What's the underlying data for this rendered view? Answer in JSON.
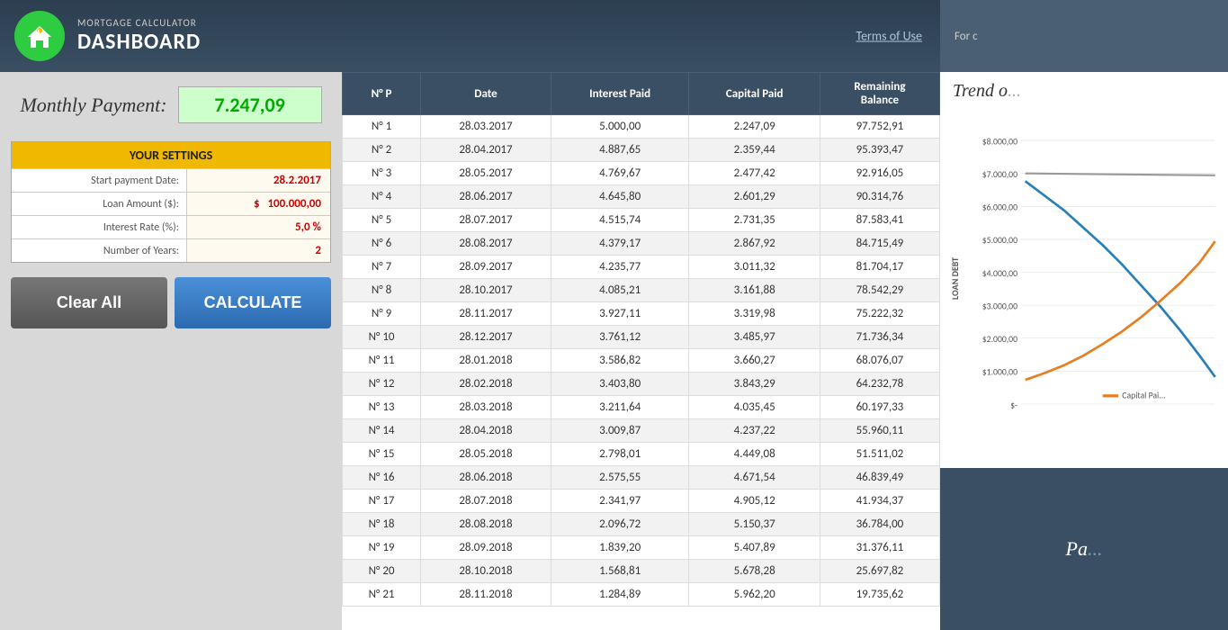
{
  "header": {
    "logo_alt": "house-icon",
    "subtitle": "MORTGAGE CALCULATOR",
    "title": "DASHBOARD",
    "terms_label": "Terms of Use",
    "for_label": "For c"
  },
  "monthly_payment": {
    "label": "Monthly Payment:",
    "value": "7.247,09"
  },
  "settings": {
    "title": "YOUR SETTINGS",
    "fields": [
      {
        "label": "Start payment Date:",
        "value": "28.2.2017"
      },
      {
        "label": "Loan Amount ($):",
        "value": "$   100.000,00"
      },
      {
        "label": "Interest Rate (%):",
        "value": "5,0 %"
      },
      {
        "label": "Number of Years:",
        "value": "2"
      }
    ]
  },
  "buttons": {
    "clear_label": "Clear All",
    "calculate_label": "CALCULATE"
  },
  "table": {
    "headers": [
      "N° P",
      "Date",
      "Interest Paid",
      "Capital Paid",
      "Remaining\nBalance"
    ],
    "rows": [
      [
        "N° 1",
        "28.03.2017",
        "5.000,00",
        "2.247,09",
        "97.752,91"
      ],
      [
        "N° 2",
        "28.04.2017",
        "4.887,65",
        "2.359,44",
        "95.393,47"
      ],
      [
        "N° 3",
        "28.05.2017",
        "4.769,67",
        "2.477,42",
        "92.916,05"
      ],
      [
        "N° 4",
        "28.06.2017",
        "4.645,80",
        "2.601,29",
        "90.314,76"
      ],
      [
        "N° 5",
        "28.07.2017",
        "4.515,74",
        "2.731,35",
        "87.583,41"
      ],
      [
        "N° 6",
        "28.08.2017",
        "4.379,17",
        "2.867,92",
        "84.715,49"
      ],
      [
        "N° 7",
        "28.09.2017",
        "4.235,77",
        "3.011,32",
        "81.704,17"
      ],
      [
        "N° 8",
        "28.10.2017",
        "4.085,21",
        "3.161,88",
        "78.542,29"
      ],
      [
        "N° 9",
        "28.11.2017",
        "3.927,11",
        "3.319,98",
        "75.222,32"
      ],
      [
        "N° 10",
        "28.12.2017",
        "3.761,12",
        "3.485,97",
        "71.736,34"
      ],
      [
        "N° 11",
        "28.01.2018",
        "3.586,82",
        "3.660,27",
        "68.076,07"
      ],
      [
        "N° 12",
        "28.02.2018",
        "3.403,80",
        "3.843,29",
        "64.232,78"
      ],
      [
        "N° 13",
        "28.03.2018",
        "3.211,64",
        "4.035,45",
        "60.197,33"
      ],
      [
        "N° 14",
        "28.04.2018",
        "3.009,87",
        "4.237,22",
        "55.960,11"
      ],
      [
        "N° 15",
        "28.05.2018",
        "2.798,01",
        "4.449,08",
        "51.511,02"
      ],
      [
        "N° 16",
        "28.06.2018",
        "2.575,55",
        "4.671,54",
        "46.839,49"
      ],
      [
        "N° 17",
        "28.07.2018",
        "2.341,97",
        "4.905,12",
        "41.934,37"
      ],
      [
        "N° 18",
        "28.08.2018",
        "2.096,72",
        "5.150,37",
        "36.784,00"
      ],
      [
        "N° 19",
        "28.09.2018",
        "1.839,20",
        "5.407,89",
        "31.376,11"
      ],
      [
        "N° 20",
        "28.10.2018",
        "1.568,81",
        "5.678,28",
        "25.697,82"
      ],
      [
        "N° 21",
        "28.11.2018",
        "1.284,89",
        "5.962,20",
        "19.735,62"
      ]
    ]
  },
  "chart": {
    "title": "Trend o",
    "y_label": "LOAN DEBT",
    "y_ticks": [
      "$8.000,00",
      "$7.000,00",
      "$6.000,00",
      "$5.000,00",
      "$4.000,00",
      "$3.000,00",
      "$2.000,00",
      "$1.000,00",
      "$-"
    ],
    "legend_capital": "Capital Pai",
    "bottom_title": "Pa"
  }
}
